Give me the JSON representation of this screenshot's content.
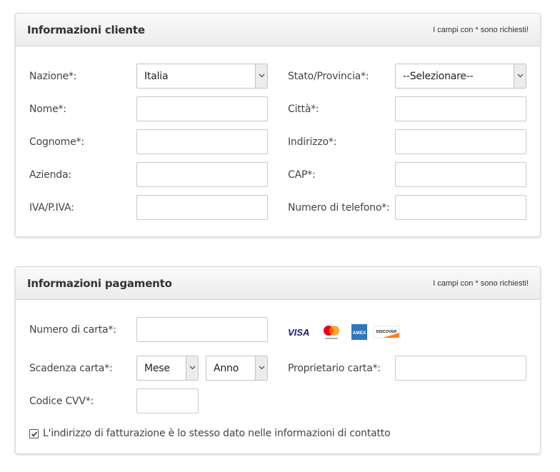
{
  "customer": {
    "title": "Informazioni cliente",
    "note": "I campi con * sono richiesti!",
    "country_label": "Nazione*:",
    "country_value": "Italia",
    "firstname_label": "Nome*:",
    "lastname_label": "Cognome*:",
    "company_label": "Azienda:",
    "vat_label": "IVA/P.IVA:",
    "state_label": "Stato/Provincia*:",
    "state_value": "--Selezionare--",
    "city_label": "Città*:",
    "address_label": "Indirizzo*:",
    "zip_label": "CAP*:",
    "phone_label": "Numero di telefono*:"
  },
  "payment": {
    "title": "Informazioni pagamento",
    "note": "I campi con * sono richiesti!",
    "card_number_label": "Numero di carta*:",
    "expiry_label": "Scadenza carta*:",
    "month_value": "Mese",
    "year_value": "Anno",
    "holder_label": "Proprietario carta*:",
    "cvv_label": "Codice CVV*:",
    "same_address_label": "L'indirizzo di fatturazione è lo stesso dato nelle informazioni di contatto",
    "same_address_checked": true,
    "cards": {
      "visa": "VISA",
      "mastercard_caption": "mastercard",
      "amex": "AMEX",
      "discover": "DISCOVER"
    }
  },
  "colors": {
    "visa": "#1a1f71",
    "mc_red": "#eb001b",
    "mc_orange": "#f79e1b",
    "amex": "#2e77bc",
    "discover": "#f58220"
  }
}
